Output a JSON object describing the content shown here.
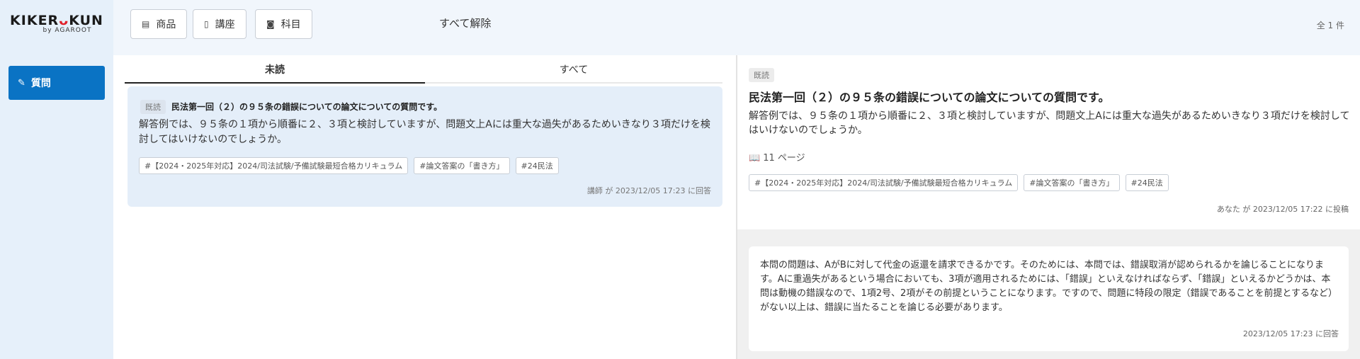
{
  "app": {
    "logo": "KIKERUKUN",
    "logo_sub": "by AGAROOT"
  },
  "sidebar": {
    "items": [
      {
        "label": "質問",
        "icon": "pencil-icon"
      }
    ]
  },
  "toolbar": {
    "filters": [
      {
        "label": "商品",
        "icon": "box-icon"
      },
      {
        "label": "講座",
        "icon": "phone-icon"
      },
      {
        "label": "科目",
        "icon": "camera-icon"
      }
    ],
    "clear_label": "すべて解除",
    "count_label": "全 1 件"
  },
  "tabs": [
    {
      "label": "未読",
      "active": true
    },
    {
      "label": "すべて",
      "active": false
    }
  ],
  "list": {
    "items": [
      {
        "badge": "既読",
        "title": "民法第一回（２）の９５条の錯誤についての論文についての質問です。",
        "body": "解答例では、９５条の１項から順番に２、３項と検討していますが、問題文上Aには重大な過失があるためいきなり３項だけを検討してはいけないのでしょうか。",
        "tags": [
          "#【2024・2025年対応】2024/司法試験/予備試験最短合格カリキュラム",
          "#論文答案の「書き方」",
          "#24民法"
        ],
        "footer": "講師 が 2023/12/05 17:23 に回答"
      }
    ]
  },
  "detail": {
    "badge": "既読",
    "title": "民法第一回（２）の９５条の錯誤についての論文についての質問です。",
    "body": "解答例では、９５条の１項から順番に２、３項と検討していますが、問題文上Aには重大な過失があるためいきなり３項だけを検討してはいけないのでしょうか。",
    "page_ref": "11 ページ",
    "tags": [
      "#【2024・2025年対応】2024/司法試験/予備試験最短合格カリキュラム",
      "#論文答案の「書き方」",
      "#24民法"
    ],
    "footer": "あなた が 2023/12/05 17:22 に投稿"
  },
  "answer": {
    "text": "本問の問題は、AがBに対して代金の返還を請求できるかです。そのためには、本問では、錯誤取消が認められるかを論じることになります。Aに重過失があるという場合においても、3項が適用されるためには、「錯誤」といえなければならず、「錯誤」といえるかどうかは、本問は動機の錯誤なので、1項2号、2項がその前提ということになります。ですので、問題に特段の限定（錯誤であることを前提とするなど）がない以上は、錯誤に当たることを論じる必要があります。",
    "footer": "2023/12/05 17:23 に回答"
  }
}
